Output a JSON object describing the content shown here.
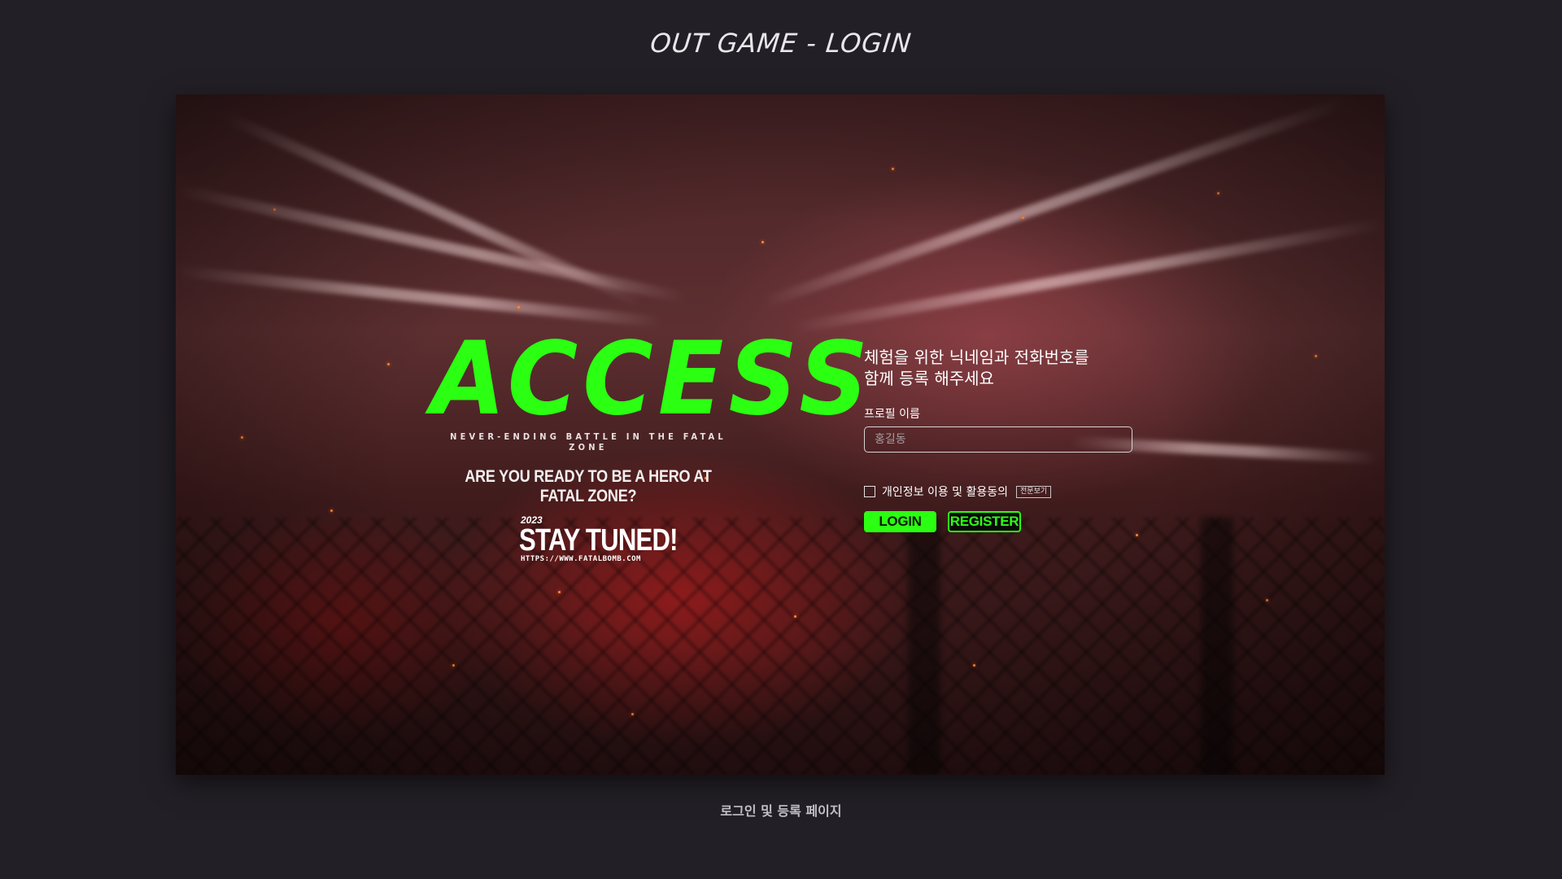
{
  "page": {
    "title": "OUT GAME - LOGIN",
    "caption": "로그인 및 등록 페이지"
  },
  "hero": {
    "headline": "ACCESS",
    "tagline": "NEVER-ENDING BATTLE IN THE FATAL ZONE",
    "question": "ARE YOU READY TO BE A HERO AT FATAL ZONE?",
    "stay_year": "2023",
    "stay_text": "STAY TUNED!",
    "stay_url": "HTTPS://WWW.FATALBOMB.COM"
  },
  "form": {
    "title_line1": "체험을 위한 닉네임과 전화번호를",
    "title_line2": "함께 등록 해주세요",
    "profile_label": "프로필 이름",
    "profile_placeholder": "홍길동",
    "profile_value": "",
    "consent_label": "개인정보 이용 및 활용동의",
    "consent_checked": false,
    "view_full_label": "전문보기",
    "login_label": "LOGIN",
    "register_label": "REGISTER"
  },
  "colors": {
    "accent_green": "#2bff12",
    "page_background": "#231f26"
  }
}
